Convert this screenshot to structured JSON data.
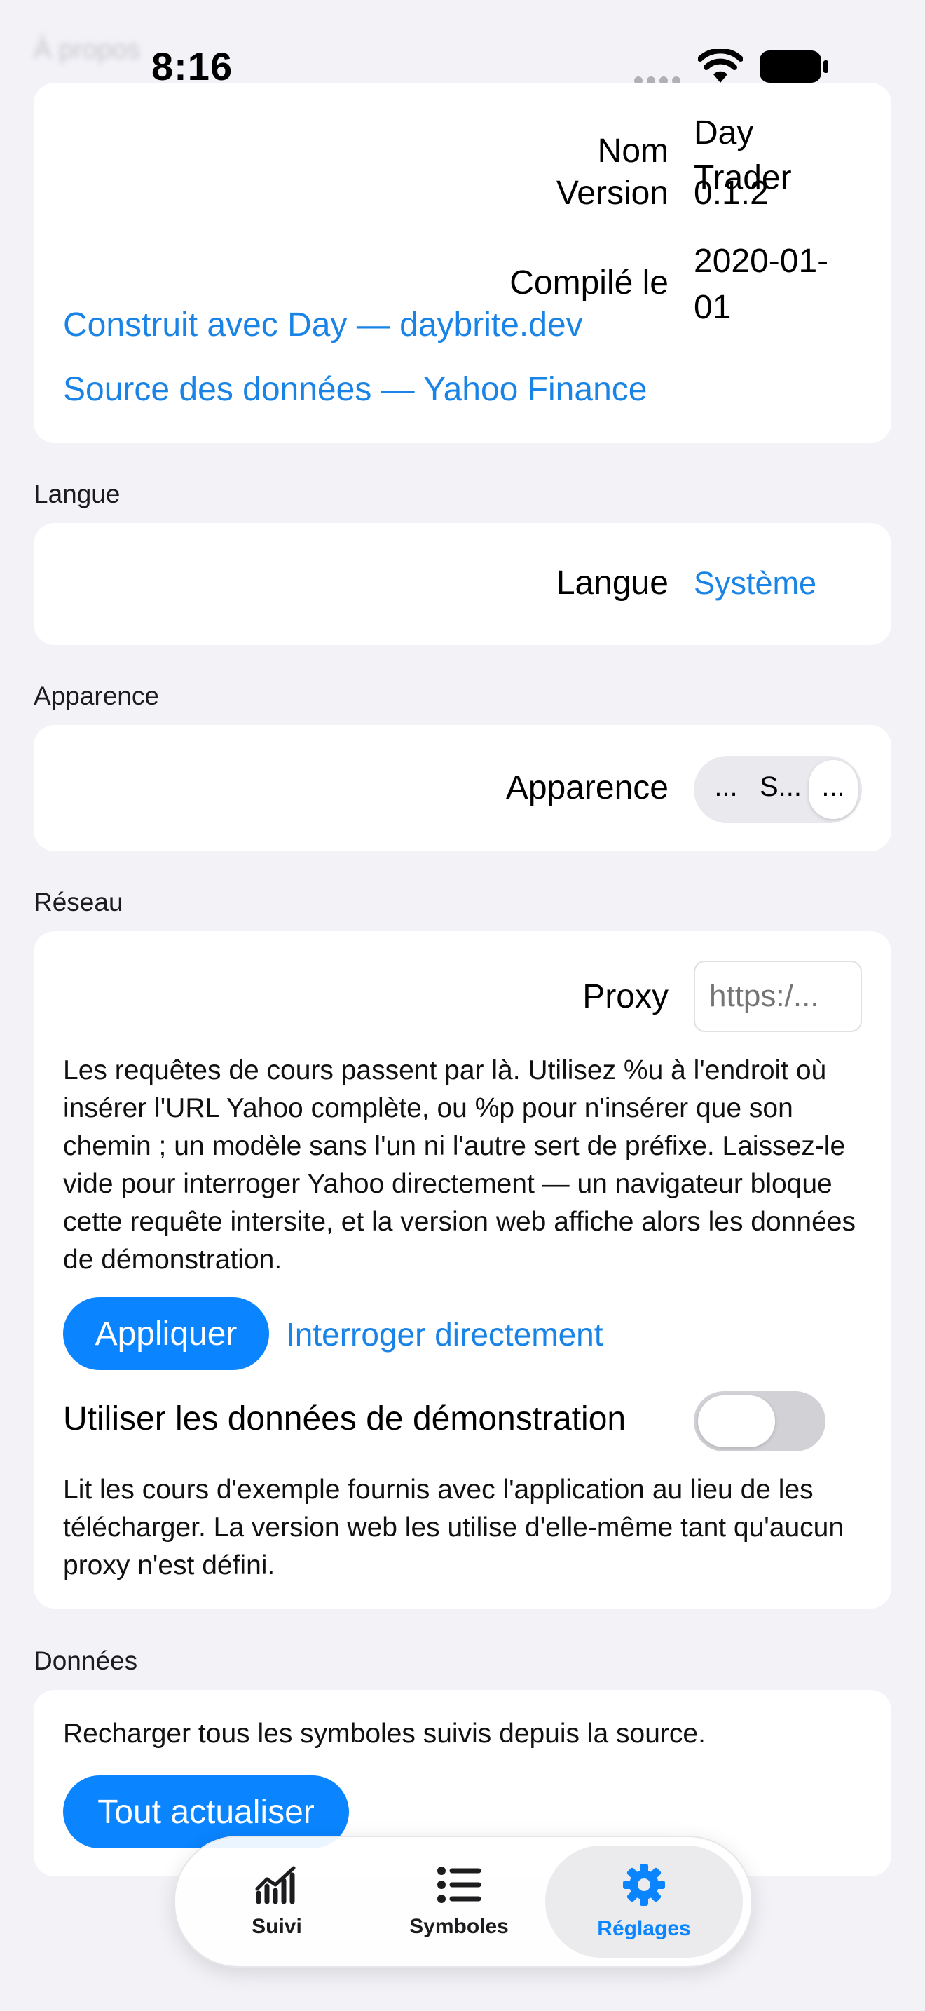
{
  "status_bar": {
    "time": "8:16"
  },
  "faded_header": "À propos",
  "about": {
    "name_label": "Nom",
    "name_value_line1": "Day",
    "name_value_line2": "Trader",
    "version_label": "Version",
    "version_value": "0.1.2",
    "compiled_label": "Compilé le",
    "compiled_value_line1": "2020-01-",
    "compiled_value_line2": "01",
    "built_with_link": "Construit avec Day — daybrite.dev",
    "data_source_link": "Source des données — Yahoo Finance"
  },
  "language": {
    "section_title": "Langue",
    "row_label": "Langue",
    "value": "Système"
  },
  "appearance": {
    "section_title": "Apparence",
    "row_label": "Apparence",
    "segments": [
      "...",
      "S...",
      "..."
    ],
    "selected_index": 2
  },
  "network": {
    "section_title": "Réseau",
    "proxy_label": "Proxy",
    "proxy_placeholder": "https:/...",
    "description": "Les requêtes de cours passent par là. Utilisez %u à l'endroit où insérer l'URL Yahoo complète, ou %p pour n'insérer que son chemin ; un modèle sans l'un ni l'autre sert de préfixe. Laissez-le vide pour interroger Yahoo directement — un navigateur bloque cette requête intersite, et la version web affiche alors les données de démonstration.",
    "apply_button": "Appliquer",
    "direct_button": "Interroger directement",
    "demo_label": "Utiliser les données de démonstration",
    "demo_enabled": false,
    "demo_description": "Lit les cours d'exemple fournis avec l'application au lieu de les télécharger. La version web les utilise d'elle-même tant qu'aucun proxy n'est défini."
  },
  "data": {
    "section_title": "Données",
    "description": "Recharger tous les symboles suivis depuis la source.",
    "refresh_button": "Tout actualiser"
  },
  "tab_bar": {
    "tabs": [
      {
        "label": "Suivi",
        "icon": "chart-icon"
      },
      {
        "label": "Symboles",
        "icon": "list-icon"
      },
      {
        "label": "Réglages",
        "icon": "gear-icon"
      }
    ],
    "active_index": 2
  },
  "colors": {
    "accent": "#0a84ff",
    "link": "#1a84e6",
    "background": "#f2f2f7"
  }
}
